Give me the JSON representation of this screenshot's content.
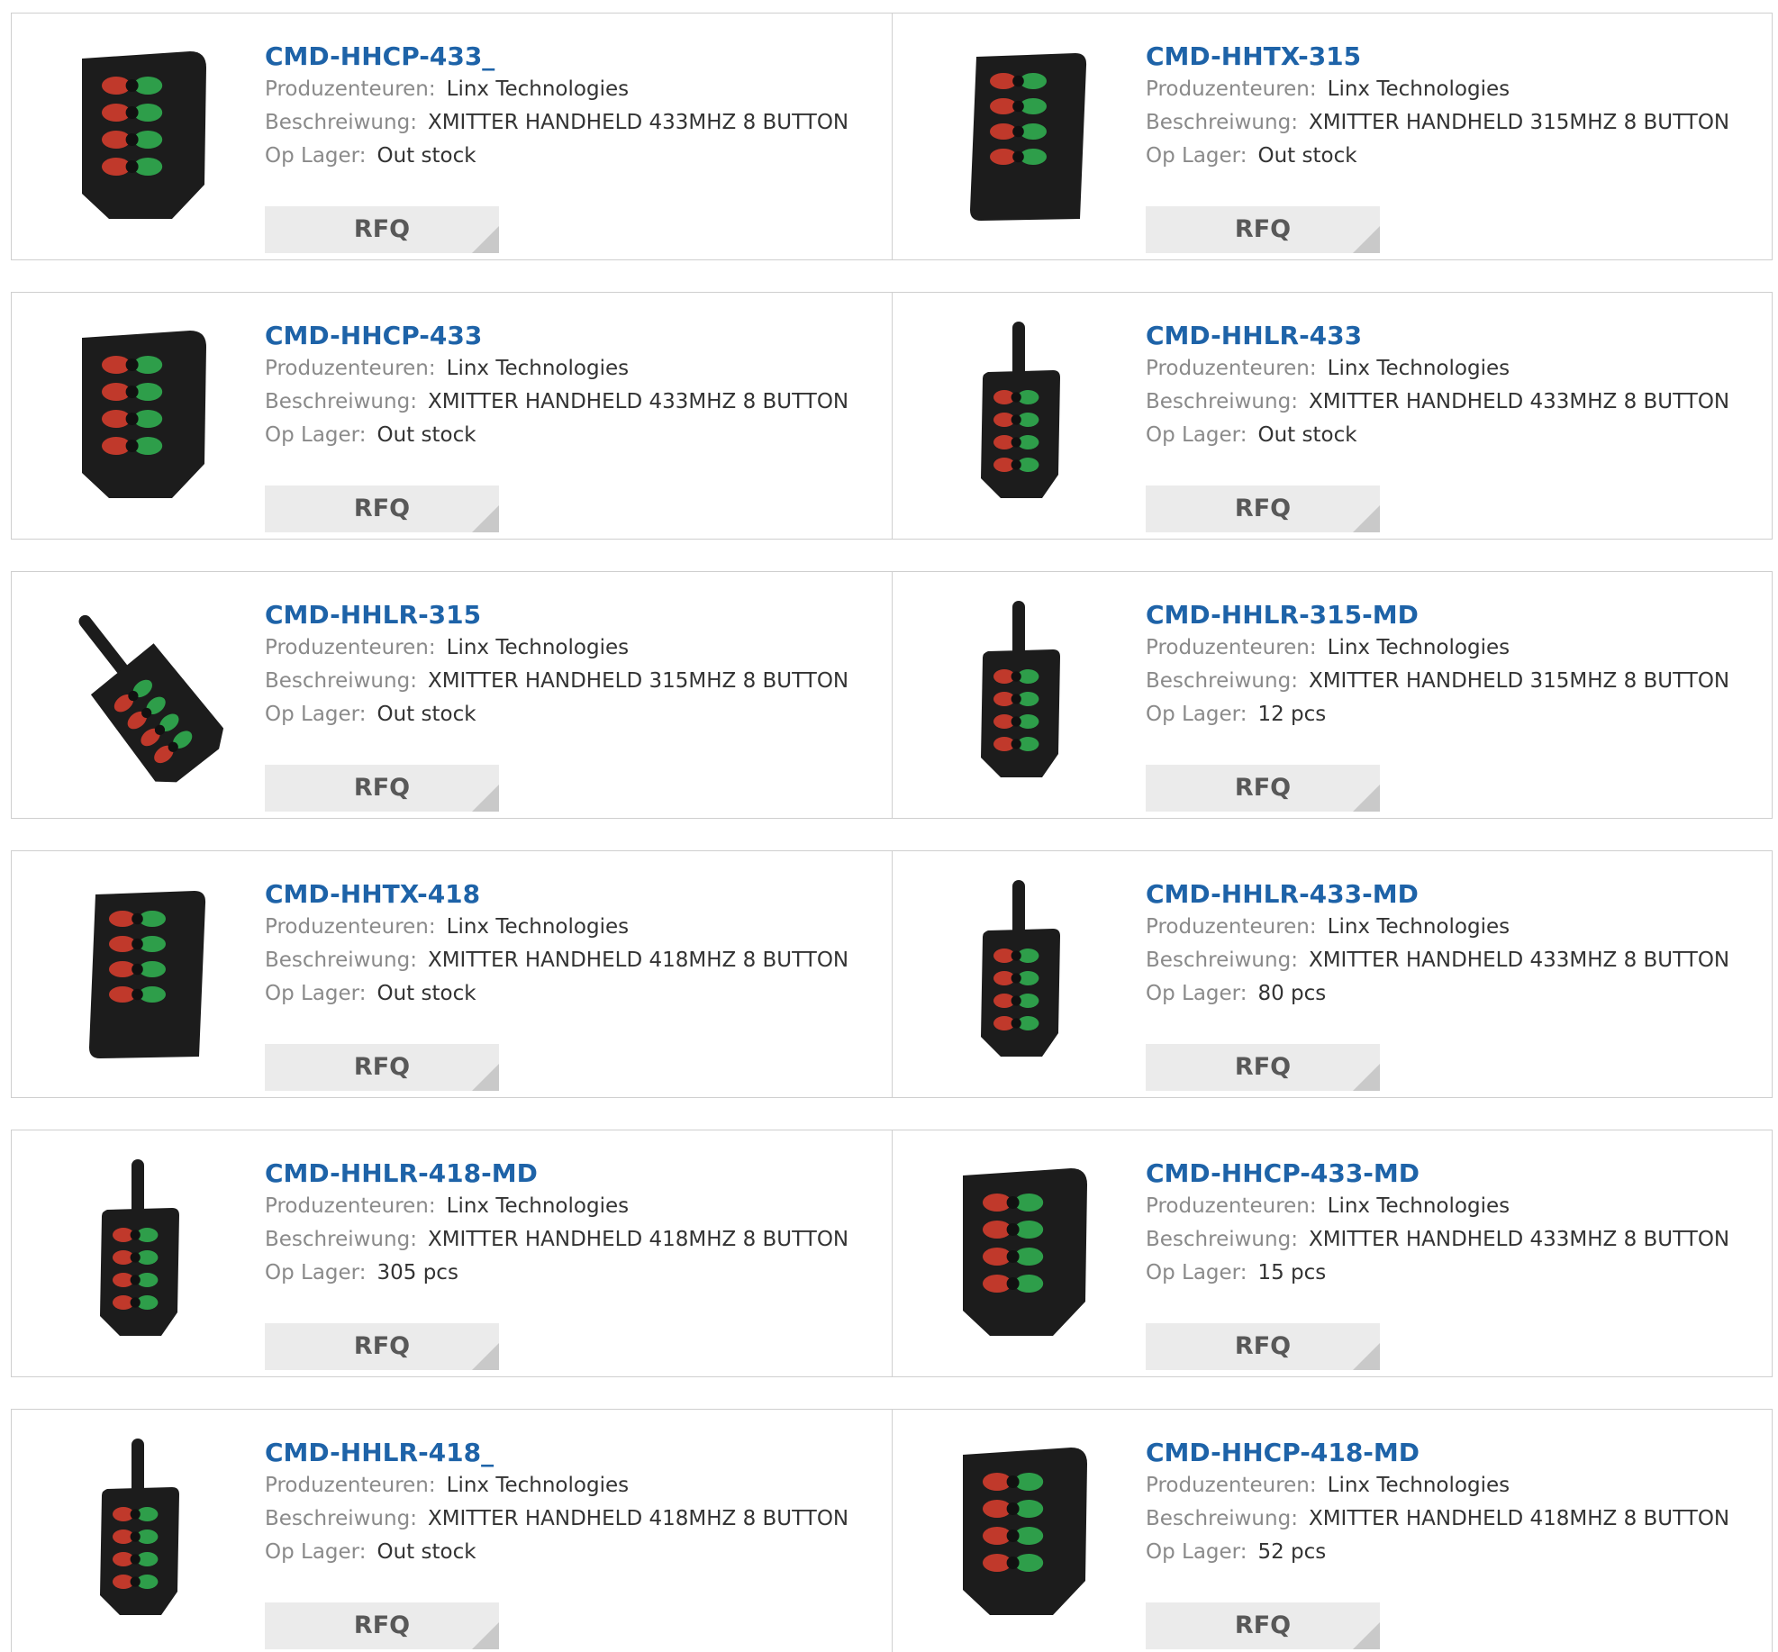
{
  "labels": {
    "manufacturer": "Produzenteuren:",
    "description": "Beschreiwung:",
    "stock": "Op Lager:",
    "rfq": "RFQ"
  },
  "products": [
    {
      "name": "CMD-HHCP-433_",
      "manufacturer": "Linx Technologies",
      "description": "XMITTER HANDHELD 433MHZ 8 BUTTON",
      "stock": "Out stock",
      "image": "remote-compact"
    },
    {
      "name": "CMD-HHTX-315",
      "manufacturer": "Linx Technologies",
      "description": "XMITTER HANDHELD 315MHZ 8 BUTTON",
      "stock": "Out stock",
      "image": "remote-long"
    },
    {
      "name": "CMD-HHCP-433",
      "manufacturer": "Linx Technologies",
      "description": "XMITTER HANDHELD 433MHZ 8 BUTTON",
      "stock": "Out stock",
      "image": "remote-compact"
    },
    {
      "name": "CMD-HHLR-433",
      "manufacturer": "Linx Technologies",
      "description": "XMITTER HANDHELD 433MHZ 8 BUTTON",
      "stock": "Out stock",
      "image": "remote-antenna"
    },
    {
      "name": "CMD-HHLR-315",
      "manufacturer": "Linx Technologies",
      "description": "XMITTER HANDHELD 315MHZ 8 BUTTON",
      "stock": "Out stock",
      "image": "remote-antenna-tilted"
    },
    {
      "name": "CMD-HHLR-315-MD",
      "manufacturer": "Linx Technologies",
      "description": "XMITTER HANDHELD 315MHZ 8 BUTTON",
      "stock": "12 pcs",
      "image": "remote-antenna"
    },
    {
      "name": "CMD-HHTX-418",
      "manufacturer": "Linx Technologies",
      "description": "XMITTER HANDHELD 418MHZ 8 BUTTON",
      "stock": "Out stock",
      "image": "remote-long"
    },
    {
      "name": "CMD-HHLR-433-MD",
      "manufacturer": "Linx Technologies",
      "description": "XMITTER HANDHELD 433MHZ 8 BUTTON",
      "stock": "80 pcs",
      "image": "remote-antenna"
    },
    {
      "name": "CMD-HHLR-418-MD",
      "manufacturer": "Linx Technologies",
      "description": "XMITTER HANDHELD 418MHZ 8 BUTTON",
      "stock": "305 pcs",
      "image": "remote-antenna"
    },
    {
      "name": "CMD-HHCP-433-MD",
      "manufacturer": "Linx Technologies",
      "description": "XMITTER HANDHELD 433MHZ 8 BUTTON",
      "stock": "15 pcs",
      "image": "remote-compact"
    },
    {
      "name": "CMD-HHLR-418_",
      "manufacturer": "Linx Technologies",
      "description": "XMITTER HANDHELD 418MHZ 8 BUTTON",
      "stock": "Out stock",
      "image": "remote-antenna"
    },
    {
      "name": "CMD-HHCP-418-MD",
      "manufacturer": "Linx Technologies",
      "description": "XMITTER HANDHELD 418MHZ 8 BUTTON",
      "stock": "52 pcs",
      "image": "remote-compact"
    }
  ],
  "colors": {
    "title": "#1e63a8",
    "button_red": "#c0392b",
    "button_green": "#2e9e4a",
    "body": "#1c1c1c"
  }
}
